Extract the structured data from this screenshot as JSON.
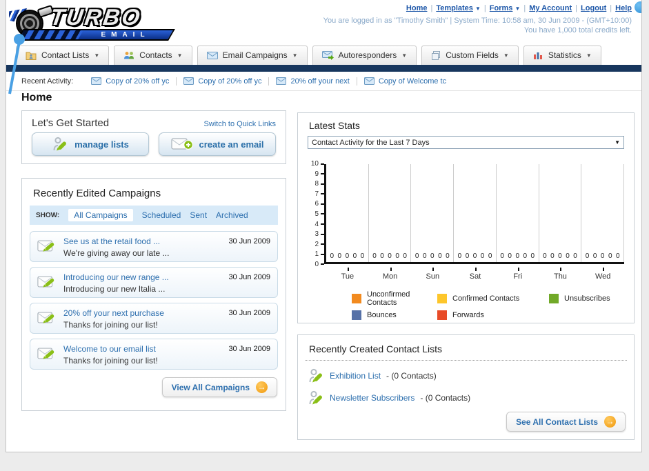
{
  "header": {
    "logo": {
      "title": "TURBO",
      "subtitle": "EMAIL"
    },
    "nav_links": [
      {
        "label": "Home",
        "has_dropdown": false
      },
      {
        "label": "Templates",
        "has_dropdown": true
      },
      {
        "label": "Forms",
        "has_dropdown": true
      },
      {
        "label": "My Account",
        "has_dropdown": false
      },
      {
        "label": "Logout",
        "has_dropdown": false
      },
      {
        "label": "Help",
        "has_dropdown": false
      }
    ],
    "login_line1": "You are logged in as \"Timothy Smith\" | System Time: 10:58 am, 30 Jun 2009 - (GMT+10:00)",
    "login_line2": "You have 1,000 total credits left."
  },
  "tabs": [
    {
      "label": "Contact Lists",
      "icon": "contact-lists-folder-icon"
    },
    {
      "label": "Contacts",
      "icon": "contacts-people-icon"
    },
    {
      "label": "Email Campaigns",
      "icon": "email-envelope-icon"
    },
    {
      "label": "Autoresponders",
      "icon": "autoresponder-envelope-icon"
    },
    {
      "label": "Custom Fields",
      "icon": "custom-fields-pages-icon"
    },
    {
      "label": "Statistics",
      "icon": "statistics-chart-icon"
    }
  ],
  "recent_activity": {
    "label": "Recent Activity:",
    "items": [
      "Copy of 20% off yc",
      "Copy of 20% off yc",
      "20% off your next",
      "Copy of Welcome tc"
    ]
  },
  "page_title": "Home",
  "get_started": {
    "title": "Let's Get Started",
    "switch_link": "Switch to Quick Links",
    "manage_lists_label": "manage lists",
    "create_email_label": "create an email"
  },
  "campaigns": {
    "title": "Recently Edited Campaigns",
    "show_label": "SHOW:",
    "filters": [
      "All Campaigns",
      "Scheduled",
      "Sent",
      "Archived"
    ],
    "active_filter": "All Campaigns",
    "items": [
      {
        "title": "See us at the retail food ...",
        "subtitle": "We're giving away our late ...",
        "date": "30 Jun 2009"
      },
      {
        "title": "Introducing our new range ...",
        "subtitle": "Introducing our new Italia ...",
        "date": "30 Jun 2009"
      },
      {
        "title": "20% off your next purchase",
        "subtitle": "Thanks for joining our list!",
        "date": "30 Jun 2009"
      },
      {
        "title": "Welcome to our email list",
        "subtitle": "Thanks for joining our list!",
        "date": "30 Jun 2009"
      }
    ],
    "view_all_label": "View All Campaigns"
  },
  "stats": {
    "title": "Latest Stats",
    "dropdown_value": "Contact Activity for the Last 7 Days"
  },
  "chart_data": {
    "type": "bar",
    "title": "Contact Activity for the Last 7 Days",
    "categories": [
      "Tue",
      "Mon",
      "Sun",
      "Sat",
      "Fri",
      "Thu",
      "Wed"
    ],
    "series": [
      {
        "name": "Unconfirmed Contacts",
        "color": "#F28A1F",
        "values": [
          0,
          0,
          0,
          0,
          0,
          0,
          0
        ]
      },
      {
        "name": "Confirmed Contacts",
        "color": "#FDC62B",
        "values": [
          0,
          0,
          0,
          0,
          0,
          0,
          0
        ]
      },
      {
        "name": "Unsubscribes",
        "color": "#71A928",
        "values": [
          0,
          0,
          0,
          0,
          0,
          0,
          0
        ]
      },
      {
        "name": "Bounces",
        "color": "#5671A7",
        "values": [
          0,
          0,
          0,
          0,
          0,
          0,
          0
        ]
      },
      {
        "name": "Forwards",
        "color": "#E84B28",
        "values": [
          0,
          0,
          0,
          0,
          0,
          0,
          0
        ]
      }
    ],
    "ylim": [
      0,
      10
    ],
    "yticks": [
      0,
      1,
      2,
      3,
      4,
      5,
      6,
      7,
      8,
      9,
      10
    ],
    "grid": "vertical-only",
    "legend_position": "bottom"
  },
  "contact_lists": {
    "title": "Recently Created Contact Lists",
    "items": [
      {
        "name": "Exhibition List",
        "detail": "- (0 Contacts)"
      },
      {
        "name": "Newsletter Subscribers",
        "detail": "- (0 Contacts)"
      }
    ],
    "see_all_label": "See All Contact Lists"
  },
  "colors": {
    "navy_bar": "#17365D",
    "link_blue": "#2D6FAE",
    "login_text": "#8AA9C9",
    "show_bar_bg": "#D8EAF8",
    "orange_arrow": "#F5A623"
  }
}
